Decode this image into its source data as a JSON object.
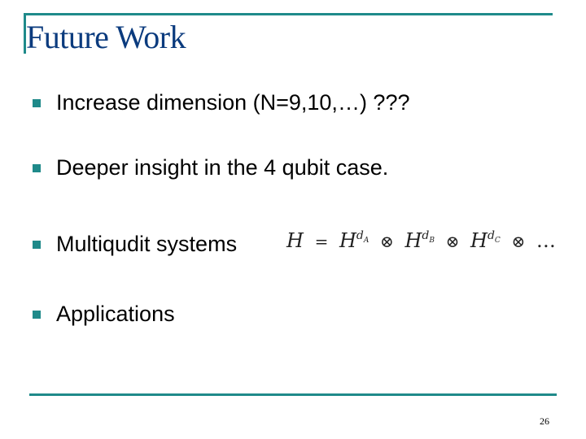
{
  "slide": {
    "title": "Future Work",
    "bullets": [
      {
        "text": "Increase dimension (N=9,10,…) ???"
      },
      {
        "text": "Deeper insight in the 4 qubit case."
      },
      {
        "text": "Multiqudit systems"
      },
      {
        "text": "Applications"
      }
    ],
    "formula": {
      "lhs": "H",
      "eq": "=",
      "terms": [
        {
          "base": "H",
          "sup": "d",
          "sub": "A"
        },
        {
          "base": "H",
          "sup": "d",
          "sub": "B"
        },
        {
          "base": "H",
          "sup": "d",
          "sub": "C"
        }
      ],
      "op": "⊗",
      "ellipsis": "…"
    },
    "page_number": "26",
    "colors": {
      "accent": "#1f8a8a",
      "title": "#0b3b7e"
    }
  }
}
